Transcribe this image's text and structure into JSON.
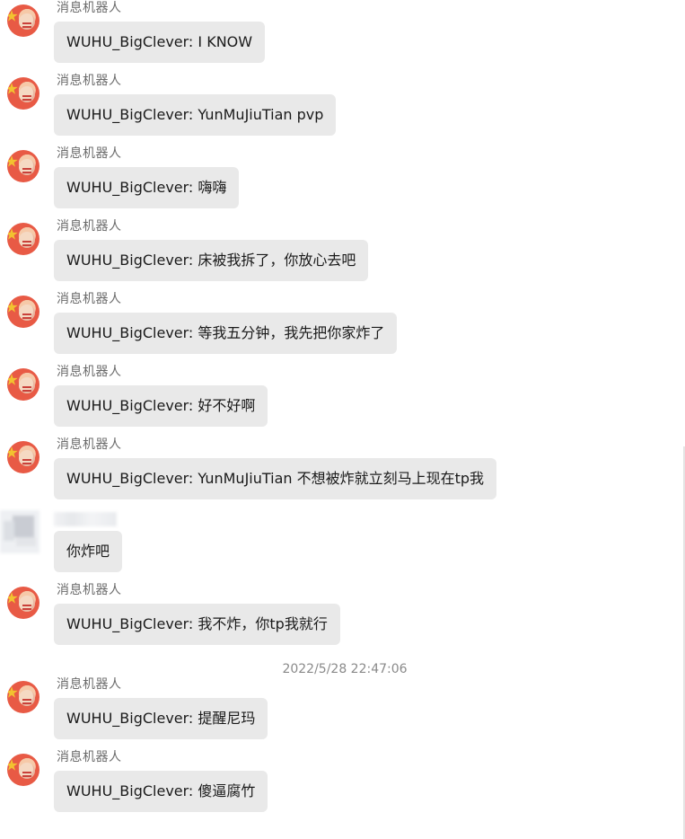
{
  "sender_name": "消息机器人",
  "timestamp": "2022/5/28 22:47:06",
  "messages": [
    {
      "sender": "消息机器人",
      "text": "WUHU_BigClever: I KNOW"
    },
    {
      "sender": "消息机器人",
      "text": "WUHU_BigClever: YunMuJiuTian pvp"
    },
    {
      "sender": "消息机器人",
      "text": "WUHU_BigClever: 嗨嗨"
    },
    {
      "sender": "消息机器人",
      "text": "WUHU_BigClever: 床被我拆了，你放心去吧"
    },
    {
      "sender": "消息机器人",
      "text": "WUHU_BigClever: 等我五分钟，我先把你家炸了"
    },
    {
      "sender": "消息机器人",
      "text": "WUHU_BigClever: 好不好啊"
    },
    {
      "sender": "消息机器人",
      "text": "WUHU_BigClever: YunMuJiuTian 不想被炸就立刻马上现在tp我"
    },
    {
      "sender": "",
      "text": "你炸吧"
    },
    {
      "sender": "消息机器人",
      "text": "WUHU_BigClever: 我不炸，你tp我就行"
    },
    {
      "sender": "消息机器人",
      "text": "WUHU_BigClever: 提醒尼玛"
    },
    {
      "sender": "消息机器人",
      "text": "WUHU_BigClever: 傻逼腐竹"
    }
  ]
}
